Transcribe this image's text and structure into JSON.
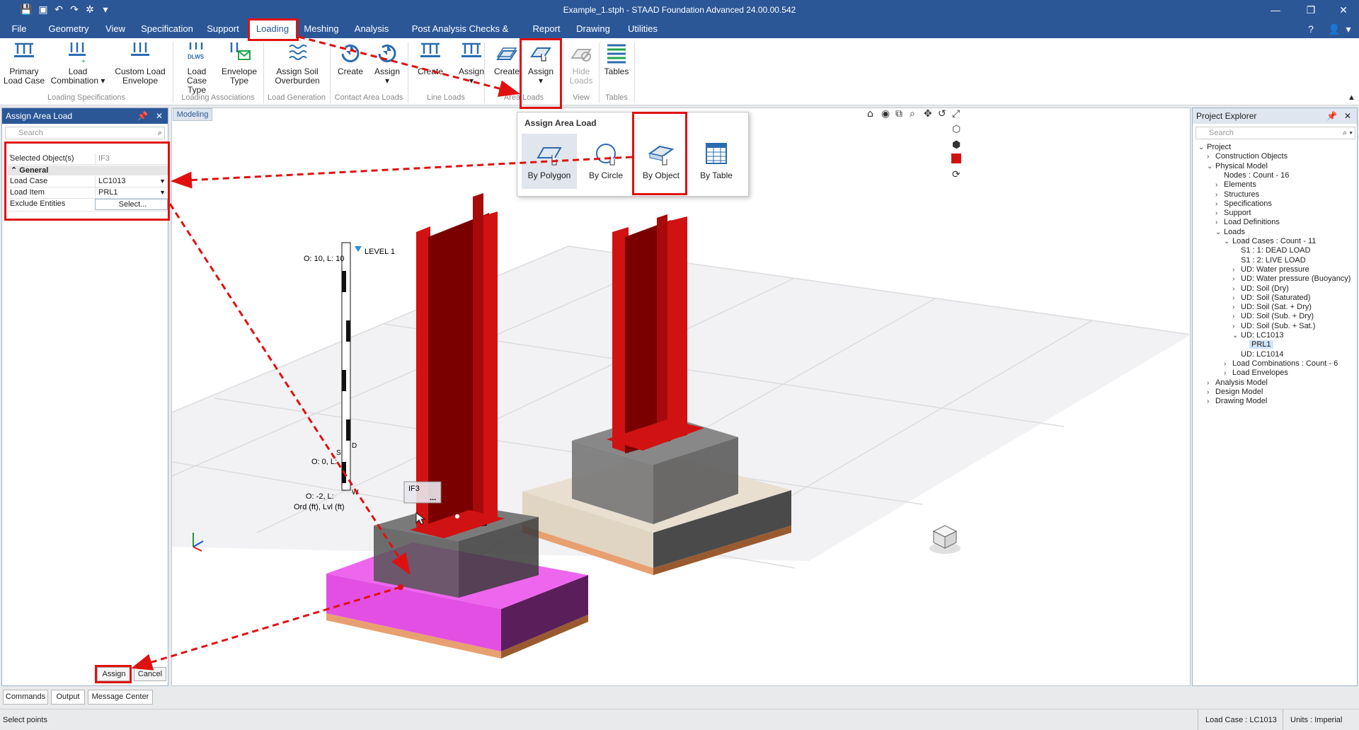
{
  "window": {
    "title": "Example_1.stph - STAAD Foundation Advanced 24.00.00.542"
  },
  "menu": {
    "tabs": [
      "File",
      "Geometry",
      "View",
      "Specification",
      "Support",
      "Loading",
      "Meshing",
      "Analysis",
      "Post Analysis Checks & Design",
      "Report",
      "Drawing",
      "Utilities"
    ],
    "active": "Loading"
  },
  "ribbon": {
    "buttons": {
      "primary": "Primary Load Case",
      "combo": "Load Combination ▾",
      "envelope": "Custom Load Envelope",
      "loadtype": "Load Case Type",
      "envtype": "Envelope Type",
      "soil": "Assign Soil Overburden",
      "ca_create": "Create",
      "ca_assign": "Assign",
      "ll_create": "Create",
      "ll_assign": "Assign",
      "al_create": "Create",
      "al_assign": "Assign",
      "hide": "Hide Loads",
      "tables": "Tables"
    },
    "groups": {
      "spec": "Loading Specifications",
      "assoc": "Loading Associations",
      "gen": "Load Generation",
      "contact": "Contact Area Loads",
      "line": "Line Loads",
      "area": "Area Loads",
      "view": "View",
      "tables": "Tables"
    }
  },
  "dropdown": {
    "title": "Assign Area Load",
    "items": [
      "By Polygon",
      "By Circle",
      "By Object",
      "By Table"
    ]
  },
  "left_panel": {
    "title": "Assign Area Load",
    "search_placeholder": "Search",
    "selected_label": "Selected Object(s)",
    "selected_value": "IF3",
    "group_general": "General",
    "load_case_label": "Load Case",
    "load_case_value": "LC1013",
    "load_item_label": "Load Item",
    "load_item_value": "PRL1",
    "exclude_label": "Exclude Entities",
    "exclude_value": "Select...",
    "assign": "Assign",
    "cancel": "Cancel"
  },
  "bottom_tabs": [
    "Commands",
    "Output",
    "Message Center"
  ],
  "viewport": {
    "tab": "Modeling",
    "level_label": "LEVEL 1",
    "o10": "O: 10, L: 10",
    "o0": "O: 0, L:",
    "om2": "O: -2, L:",
    "ord": "Ord (ft), Lvl (ft)",
    "if3": "IF3",
    "s": "S",
    "d": "D",
    "w": "W",
    "dots": "..."
  },
  "project_explorer": {
    "title": "Project Explorer",
    "search_placeholder": "Search",
    "nodes": [
      "Project",
      "Construction Objects",
      "Physical Model",
      "Nodes : Count - 16",
      "Elements",
      "Structures",
      "Specifications",
      "Support",
      "Load Definitions",
      "Loads",
      "Load Cases : Count - 11",
      "S1 : 1: DEAD LOAD",
      "S1 : 2: LIVE LOAD",
      "UD: Water pressure",
      "UD: Water pressure (Buoyancy)",
      "UD: Soil (Dry)",
      "UD: Soil (Saturated)",
      "UD: Soil (Sat. + Dry)",
      "UD: Soil (Sub. + Dry)",
      "UD: Soil (Sub. + Sat.)",
      "UD: LC1013",
      "PRL1",
      "UD: LC1014",
      "Load Combinations : Count - 6",
      "Load Envelopes",
      "Analysis Model",
      "Design Model",
      "Drawing Model"
    ]
  },
  "status": {
    "left": "Select points",
    "load_case": "Load Case : LC1013",
    "units": "Units : Imperial"
  },
  "colors": {
    "accent": "#2b5797",
    "highlight": "#e01010",
    "steel": "#d11212",
    "pad_magenta": "#ee66ee"
  }
}
